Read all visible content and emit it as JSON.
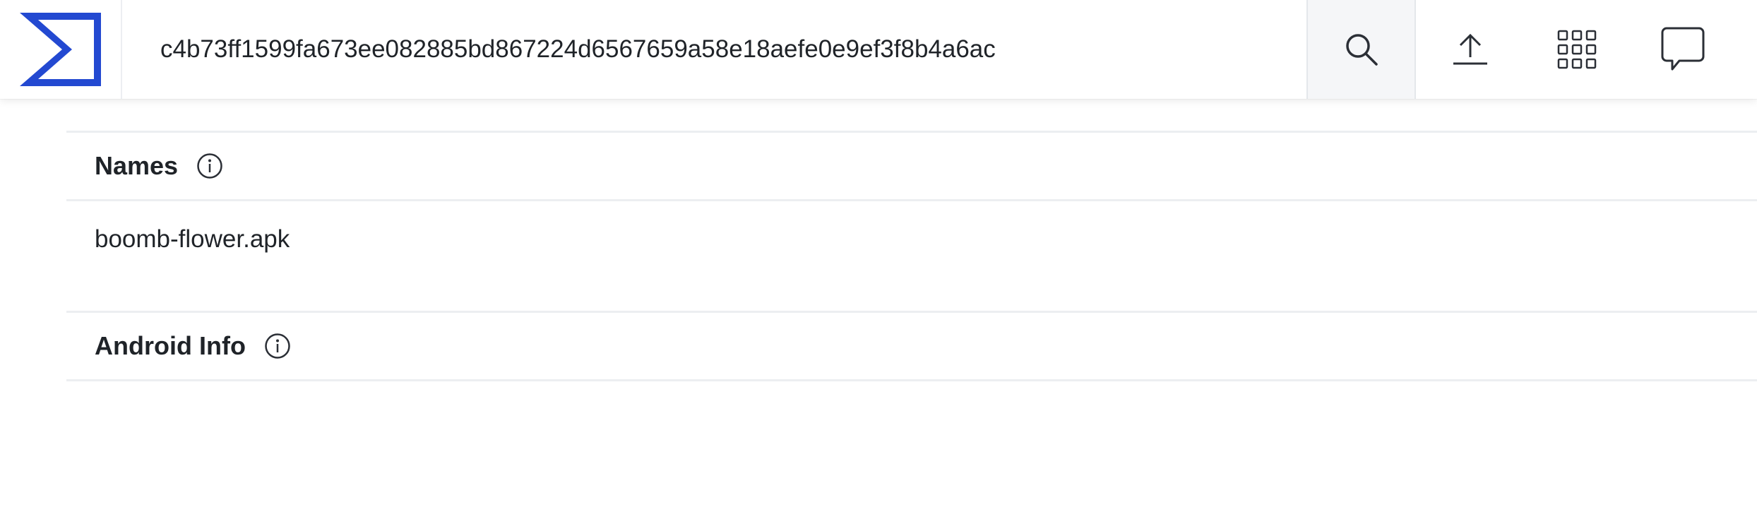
{
  "colors": {
    "brand": "#2349d1",
    "icon": "#2b2f36",
    "divider": "#eceef1"
  },
  "header": {
    "logo_icon": "sigma-logo-icon",
    "search": {
      "value": "c4b73ff1599fa673ee082885bd867224d6567659a58e18aefe0e9ef3f8b4a6ac",
      "icon": "search-icon"
    },
    "actions": [
      {
        "icon": "upload-icon"
      },
      {
        "icon": "apps-grid-icon"
      },
      {
        "icon": "chat-bubble-icon"
      }
    ]
  },
  "sections": {
    "names": {
      "title": "Names",
      "info_icon": "info-icon",
      "items": [
        "boomb-flower.apk"
      ]
    },
    "android_info": {
      "title": "Android Info",
      "info_icon": "info-icon"
    }
  }
}
